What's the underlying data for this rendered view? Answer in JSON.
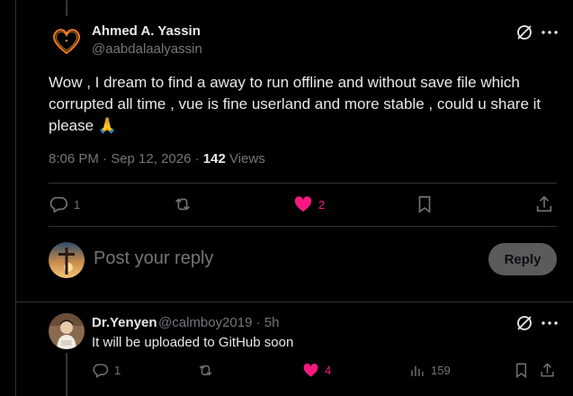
{
  "main_tweet": {
    "author_name": "Ahmed A. Yassin",
    "author_handle": "@aabdalaalyassin",
    "text": "Wow , I dream to find a away to run offline and without save file which corrupted all time , vue is fine userland and more stable , could u share it please 🙏",
    "timestamp": "8:06 PM · Sep 12, 2026 · ",
    "views_count": "142",
    "views_label": " Views",
    "replies": "1",
    "retweets": "",
    "likes": "2",
    "liked": true
  },
  "composer": {
    "placeholder": "Post your reply",
    "reply_label": "Reply"
  },
  "reply_tweet": {
    "author_name": "Dr.Yenyen",
    "author_handle": "@calmboy2019 · 5h",
    "text": "It will be uploaded to GitHub soon",
    "replies": "1",
    "retweets": "",
    "likes": "4",
    "views": "159",
    "liked": true
  },
  "colors": {
    "background": "#000000",
    "text_primary": "#e7e9ea",
    "text_secondary": "#71767b",
    "like": "#f91880",
    "divider": "#2f3336"
  }
}
